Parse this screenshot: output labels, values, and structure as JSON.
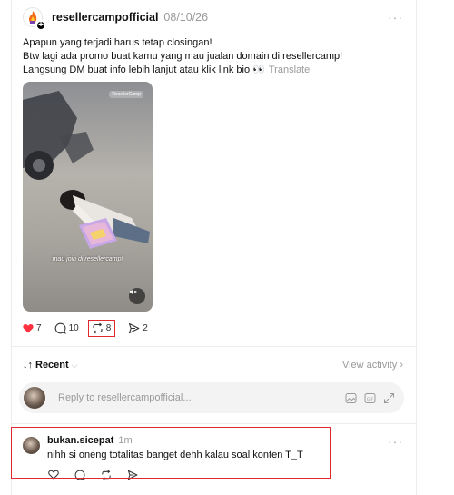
{
  "post": {
    "username": "resellercampofficial",
    "timestamp": "08/10/26",
    "more": "···",
    "lines": [
      "Apapun yang terjadi harus tetap closingan!",
      "Btw lagi ada promo buat kamu yang mau jualan domain di resellercamp!",
      "Langsung DM buat info lebih lanjut atau klik link bio 👀"
    ],
    "translate": "Translate",
    "media": {
      "logo_text": "ResellerCamp",
      "caption": "mau join di resellercamp!"
    },
    "actions": {
      "likes": "7",
      "comments": "10",
      "reposts": "8",
      "shares": "2"
    },
    "icons": {
      "like": "heart-filled-icon",
      "comment": "comment-bubble-icon",
      "repost": "repost-icon",
      "share": "share-arrow-icon"
    },
    "colors": {
      "like": "#ff3040",
      "highlight": "#e0282e"
    }
  },
  "sort": {
    "label": "Recent",
    "view_activity": "View activity"
  },
  "reply_box": {
    "placeholder": "Reply to resellercampofficial..."
  },
  "comment": {
    "username": "bukan.sicepat",
    "time": "1m",
    "text": "nihh si oneng totalitas banget dehh kalau soal konten T_T",
    "more": "···"
  }
}
